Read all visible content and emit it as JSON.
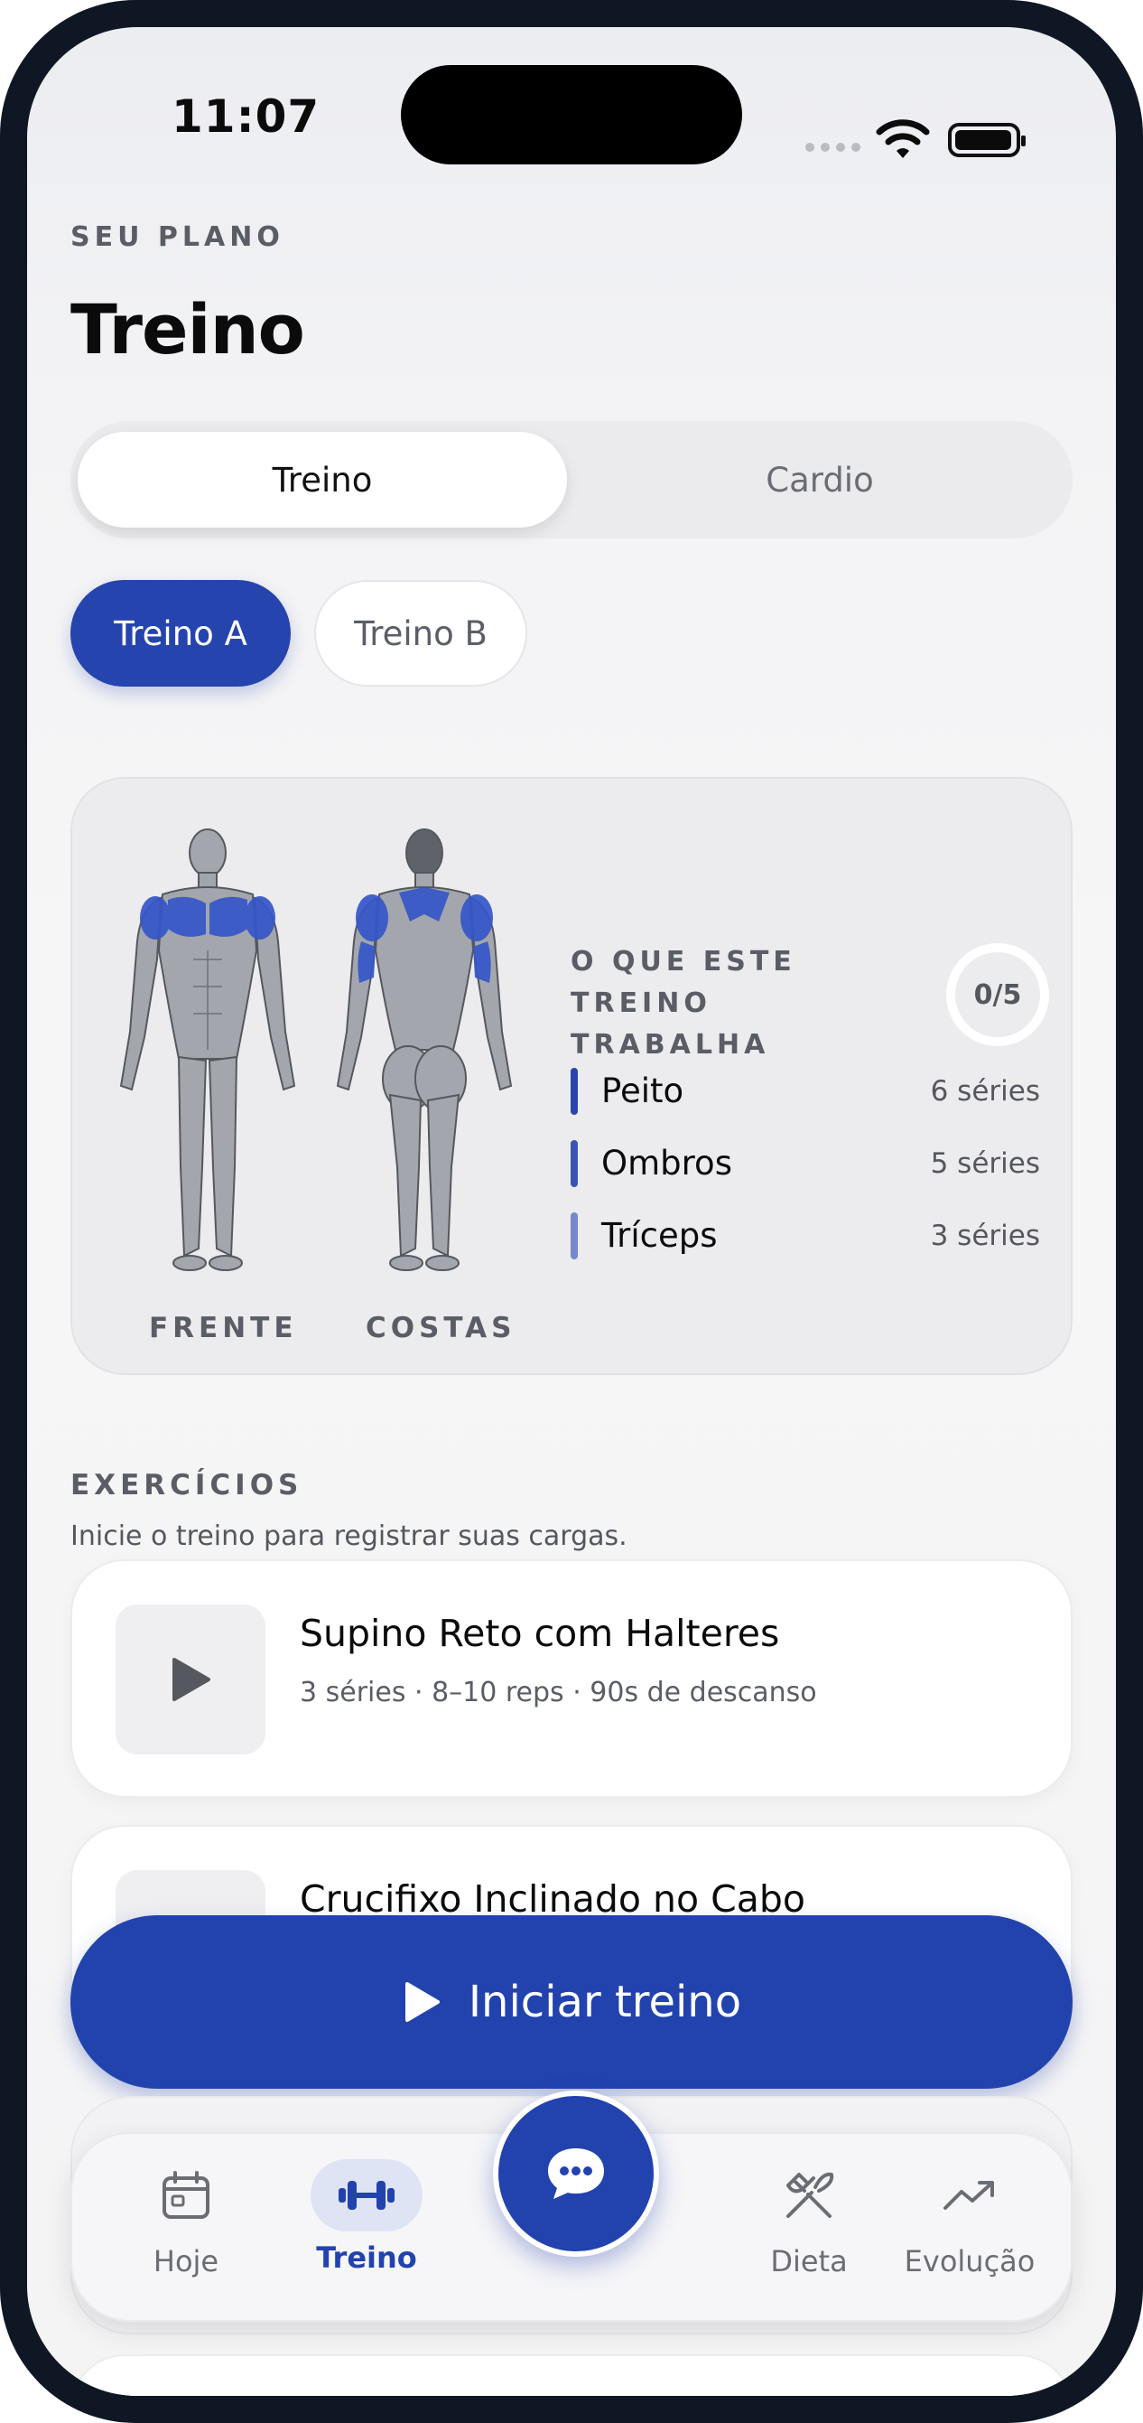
{
  "status_bar": {
    "time": "11:07"
  },
  "header": {
    "eyebrow": "SEU PLANO",
    "title": "Treino"
  },
  "segmented": {
    "options": [
      "Treino",
      "Cardio"
    ],
    "selected": "Treino"
  },
  "workout_chips": {
    "options": [
      "Treino A",
      "Treino B"
    ],
    "selected": "Treino A"
  },
  "muscle_card": {
    "front_label": "FRENTE",
    "back_label": "COSTAS",
    "title_line1": "O QUE ESTE TREINO",
    "title_line2": "TRABALHA",
    "progress": "0/5",
    "muscles": [
      {
        "name": "Peito",
        "sets": "6 séries",
        "color": "#2a45ae"
      },
      {
        "name": "Ombros",
        "sets": "5 séries",
        "color": "#3a55b6"
      },
      {
        "name": "Tríceps",
        "sets": "3 séries",
        "color": "#7688cc"
      }
    ]
  },
  "exercises": {
    "eyebrow": "EXERCÍCIOS",
    "subtitle": "Inicie o treino para registrar suas cargas.",
    "items": [
      {
        "name": "Supino Reto com Halteres",
        "meta": "3 séries · 8–10 reps · 90s de descanso"
      },
      {
        "name": "Crucifixo Inclinado no Cabo",
        "meta": ""
      }
    ]
  },
  "start_button": {
    "label": "Iniciar treino",
    "icon": "play-icon"
  },
  "tab_bar": {
    "tabs": [
      {
        "label": "Hoje",
        "icon": "calendar-icon"
      },
      {
        "label": "Treino",
        "icon": "dumbbell-icon"
      },
      {
        "label": "Dieta",
        "icon": "utensils-icon"
      },
      {
        "label": "Evolução",
        "icon": "trend-up-icon"
      }
    ],
    "active": "Treino",
    "center_icon": "chat-icon"
  },
  "colors": {
    "accent": "#2243ad",
    "muscle_highlight": "#3556c9"
  }
}
